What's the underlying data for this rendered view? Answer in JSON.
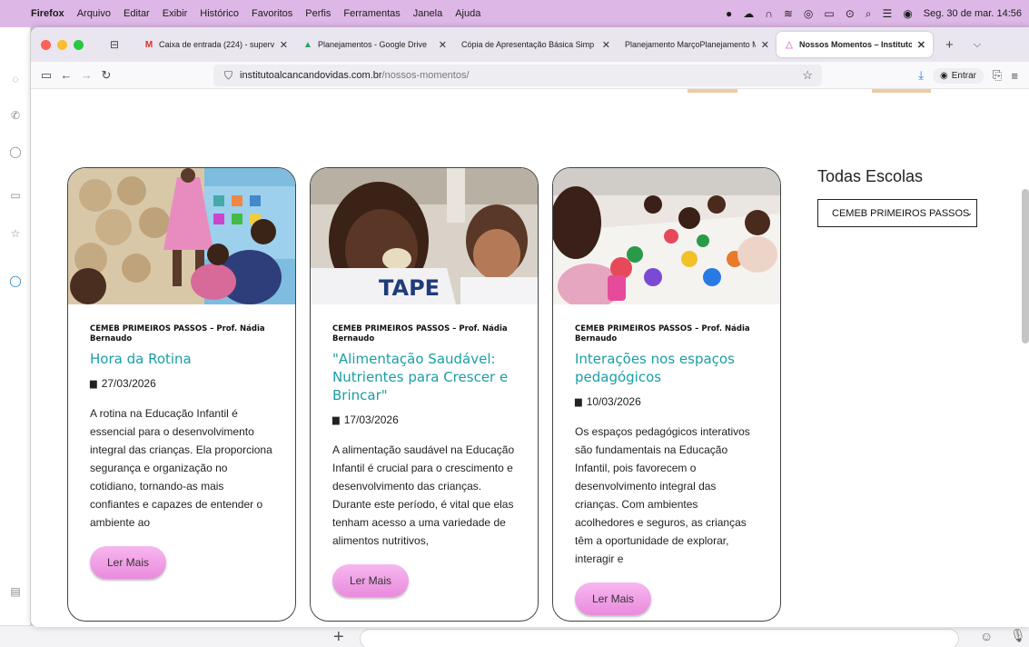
{
  "menubar": {
    "app": "Firefox",
    "items": [
      "Arquivo",
      "Editar",
      "Exibir",
      "Histórico",
      "Favoritos",
      "Perfis",
      "Ferramentas",
      "Janela",
      "Ajuda"
    ],
    "clock": "Seg. 30 de mar.  14:56"
  },
  "tabs": [
    {
      "title": "Caixa de entrada (224) - superv",
      "icon": "gmail-icon"
    },
    {
      "title": "Planejamentos - Google Drive",
      "icon": "drive-icon"
    },
    {
      "title": "Cópia de Apresentação Básica Simp",
      "icon": "slides-icon"
    },
    {
      "title": "Planejamento MarçoPlanejamento M",
      "icon": "doc-icon"
    },
    {
      "title": "Nossos Momentos – Instituto Al",
      "icon": "site-icon"
    }
  ],
  "url": {
    "domain": "institutoalcancandovidas.com.br",
    "path": "/nossos-momentos/"
  },
  "nav": {
    "signin": "Entrar"
  },
  "cards": [
    {
      "school": "CEMEB PRIMEIROS PASSOS – Prof. Nádia Bernaudo",
      "title": "Hora da Rotina",
      "date": "27/03/2026",
      "text": "A rotina na Educação Infantil é essencial para o desenvolvimento integral das crianças. Ela proporciona segurança e organização no cotidiano, tornando-as mais confiantes e capazes de entender o ambiente ao",
      "button": "Ler Mais"
    },
    {
      "school": "CEMEB PRIMEIROS PASSOS – Prof. Nádia Bernaudo",
      "title": "\"Alimentação Saudável: Nutrientes para Crescer e Brincar\"",
      "date": "17/03/2026",
      "text": "A alimentação saudável na Educação Infantil é crucial para o crescimento e desenvolvimento das crianças. Durante este período, é vital que elas tenham acesso a uma variedade de alimentos nutritivos,",
      "button": "Ler Mais"
    },
    {
      "school": "CEMEB PRIMEIROS PASSOS – Prof. Nádia Bernaudo",
      "title": "Interações nos espaços pedagógicos",
      "date": "10/03/2026",
      "text": "Os espaços pedagógicos interativos são fundamentais na Educação Infantil, pois favorecem o desenvolvimento integral das crianças. Com ambientes acolhedores e seguros, as crianças têm a oportunidade de explorar, interagir e",
      "button": "Ler Mais"
    }
  ],
  "sidebar": {
    "title": "Todas Escolas",
    "select_value": "CEMEB PRIMEIROS PASSOS"
  },
  "colors": {
    "accent_title": "#1a9ea6",
    "button_pink": "#f0a2e6",
    "menubar": "#ddb8e6"
  }
}
